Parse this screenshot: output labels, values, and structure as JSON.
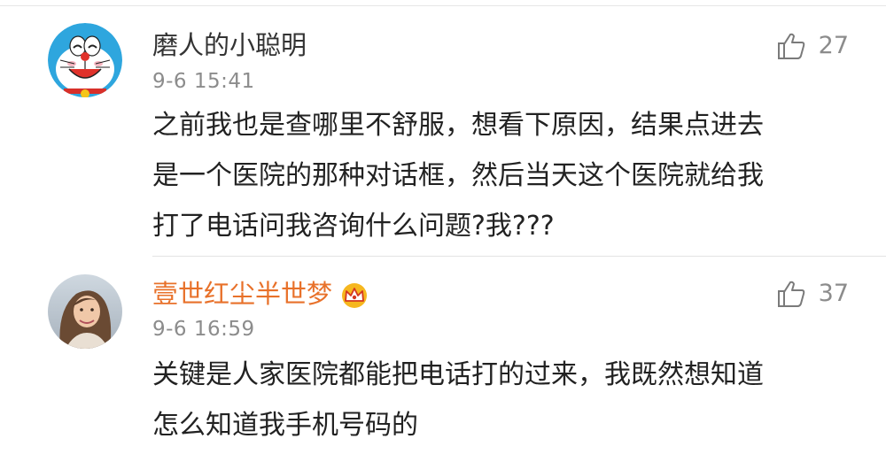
{
  "comments": [
    {
      "username": "磨人的小聪明",
      "time": "9-6 15:41",
      "likes": "27",
      "text_lines": [
        "之前我也是查哪里不舒服，想看下原因，结果点进去",
        "是一个医院的那种对话框，然后当天这个医院就给我",
        "打了电话问我咨询什么问题?我???"
      ],
      "avatar_icon": "doraemon-avatar",
      "badge_icon": null
    },
    {
      "username": "壹世红尘半世梦",
      "time": "9-6 16:59",
      "likes": "37",
      "text_lines": [
        "关键是人家医院都能把电话打的过来，我既然想知道",
        "怎么知道我手机号码的"
      ],
      "avatar_icon": "user-photo-avatar",
      "badge_icon": "crown-icon",
      "username_color": "#e8712a"
    }
  ]
}
